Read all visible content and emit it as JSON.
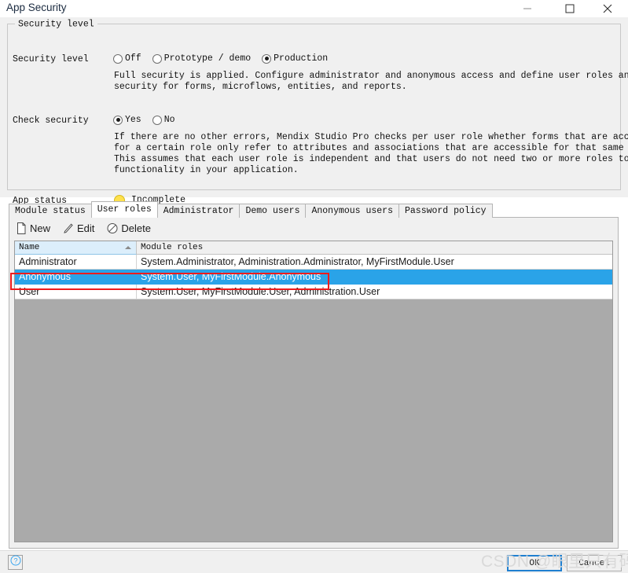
{
  "window": {
    "title": "App Security",
    "controls": [
      {
        "name": "minimize",
        "glyph": "minimize-icon"
      },
      {
        "name": "maximize",
        "glyph": "maximize-icon"
      },
      {
        "name": "close",
        "glyph": "close-icon"
      }
    ]
  },
  "security_panel": {
    "legend": "Security level",
    "security_level": {
      "label": "Security level",
      "options": [
        {
          "label": "Off",
          "checked": false
        },
        {
          "label": "Prototype / demo",
          "checked": false
        },
        {
          "label": "Production",
          "checked": true
        }
      ],
      "description": "Full security is applied. Configure administrator and anonymous access and define user roles and\nsecurity for forms, microflows, entities, and reports."
    },
    "check_security": {
      "label": "Check security",
      "options": [
        {
          "label": "Yes",
          "checked": true
        },
        {
          "label": "No",
          "checked": false
        }
      ],
      "description": "If there are no other errors, Mendix Studio Pro checks per user role whether forms that are accessible\nfor a certain role only refer to attributes and associations that are accessible for that same role.\nThis assumes that each user role is independent and that users do not need two or more roles to access\nfunctionality in your application."
    },
    "app_status": {
      "label": "App status",
      "value": "Incomplete",
      "indicator_color": "#ffe14d"
    }
  },
  "tabs": [
    {
      "label": "Module status",
      "active": false
    },
    {
      "label": "User roles",
      "active": true
    },
    {
      "label": "Administrator",
      "active": false
    },
    {
      "label": "Demo users",
      "active": false
    },
    {
      "label": "Anonymous users",
      "active": false
    },
    {
      "label": "Password policy",
      "active": false
    }
  ],
  "toolbar": {
    "new_label": "New",
    "edit_label": "Edit",
    "delete_label": "Delete"
  },
  "grid": {
    "columns": [
      {
        "label": "Name",
        "sorted": true,
        "sort_direction": "ascending"
      },
      {
        "label": "Module roles",
        "sorted": false,
        "sort_direction": ""
      }
    ],
    "rows": [
      {
        "name": "Administrator",
        "module_roles": "System.Administrator, Administration.Administrator, MyFirstModule.User",
        "selected": false
      },
      {
        "name": "Anonymous",
        "module_roles": "System.User, MyFirstModule.Anonymous",
        "selected": true
      },
      {
        "name": "User",
        "module_roles": "System.User, MyFirstModule.User, Administration.User",
        "selected": false
      }
    ]
  },
  "footer": {
    "help_label": "?",
    "ok_label": "OK",
    "cancel_label": "Cancel"
  },
  "watermark": {
    "text": "CSDN @眼里只有码"
  },
  "colors": {
    "selection_blue": "#2aa3e8",
    "annotation_red": "#ee1c1c",
    "panel_gray": "#f0f0f0",
    "grid_empty_gray": "#aaaaaa",
    "focus_blue": "#1f7fd0"
  }
}
